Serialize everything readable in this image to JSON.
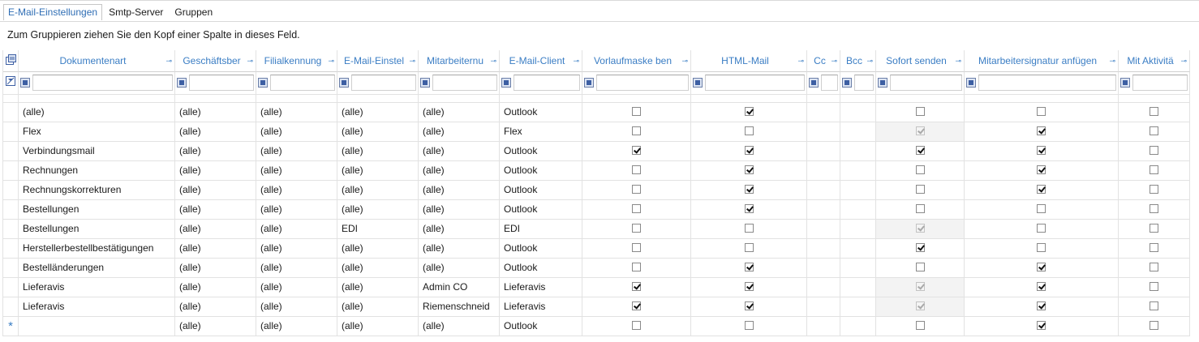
{
  "tabs": [
    "E-Mail-Einstellungen",
    "Smtp-Server",
    "Gruppen"
  ],
  "group_hint": "Zum Gruppieren ziehen Sie den Kopf einer Spalte in dieses Feld.",
  "columns": [
    "Dokumentenart",
    "Geschäftsber",
    "Filialkennung",
    "E-Mail-Einstel",
    "Mitarbeiternu",
    "E-Mail-Client",
    "Vorlaufmaske ben",
    "HTML-Mail",
    "Cc",
    "Bcc",
    "Sofort senden",
    "Mitarbeitersignatur anfügen",
    "Mit Aktivitä"
  ],
  "rows": [
    {
      "dok": "(alle)",
      "gesch": "(alle)",
      "filial": "(alle)",
      "einst": "(alle)",
      "mitarb": "(alle)",
      "client": "Outlook",
      "vorlauf": false,
      "html": true,
      "sofort": false,
      "sofort_disabled": false,
      "signatur": false,
      "aktiv": false
    },
    {
      "dok": "Flex",
      "gesch": "(alle)",
      "filial": "(alle)",
      "einst": "(alle)",
      "mitarb": "(alle)",
      "client": "Flex",
      "vorlauf": false,
      "html": false,
      "sofort": true,
      "sofort_disabled": true,
      "signatur": true,
      "aktiv": false
    },
    {
      "dok": "Verbindungsmail",
      "gesch": "(alle)",
      "filial": "(alle)",
      "einst": "(alle)",
      "mitarb": "(alle)",
      "client": "Outlook",
      "vorlauf": true,
      "html": true,
      "sofort": true,
      "sofort_disabled": false,
      "signatur": true,
      "aktiv": false
    },
    {
      "dok": "Rechnungen",
      "gesch": "(alle)",
      "filial": "(alle)",
      "einst": "(alle)",
      "mitarb": "(alle)",
      "client": "Outlook",
      "vorlauf": false,
      "html": true,
      "sofort": false,
      "sofort_disabled": false,
      "signatur": true,
      "aktiv": false
    },
    {
      "dok": "Rechnungskorrekturen",
      "gesch": "(alle)",
      "filial": "(alle)",
      "einst": "(alle)",
      "mitarb": "(alle)",
      "client": "Outlook",
      "vorlauf": false,
      "html": true,
      "sofort": false,
      "sofort_disabled": false,
      "signatur": true,
      "aktiv": false
    },
    {
      "dok": "Bestellungen",
      "gesch": "(alle)",
      "filial": "(alle)",
      "einst": "(alle)",
      "mitarb": "(alle)",
      "client": "Outlook",
      "vorlauf": false,
      "html": true,
      "sofort": false,
      "sofort_disabled": false,
      "signatur": false,
      "aktiv": false
    },
    {
      "dok": "Bestellungen",
      "gesch": "(alle)",
      "filial": "(alle)",
      "einst": "EDI",
      "mitarb": "(alle)",
      "client": "EDI",
      "vorlauf": false,
      "html": false,
      "sofort": true,
      "sofort_disabled": true,
      "signatur": false,
      "aktiv": false
    },
    {
      "dok": "Herstellerbestellbestätigungen",
      "gesch": "(alle)",
      "filial": "(alle)",
      "einst": "(alle)",
      "mitarb": "(alle)",
      "client": "Outlook",
      "vorlauf": false,
      "html": false,
      "sofort": true,
      "sofort_disabled": false,
      "signatur": false,
      "aktiv": false
    },
    {
      "dok": "Bestelländerungen",
      "gesch": "(alle)",
      "filial": "(alle)",
      "einst": "(alle)",
      "mitarb": "(alle)",
      "client": "Outlook",
      "vorlauf": false,
      "html": true,
      "sofort": false,
      "sofort_disabled": false,
      "signatur": true,
      "aktiv": false
    },
    {
      "dok": "Lieferavis",
      "gesch": "(alle)",
      "filial": "(alle)",
      "einst": "(alle)",
      "mitarb": "Admin CO",
      "client": "Lieferavis",
      "vorlauf": true,
      "html": true,
      "sofort": true,
      "sofort_disabled": true,
      "signatur": true,
      "aktiv": false
    },
    {
      "dok": "Lieferavis",
      "gesch": "(alle)",
      "filial": "(alle)",
      "einst": "(alle)",
      "mitarb": "Riemenschneid",
      "client": "Lieferavis",
      "vorlauf": true,
      "html": true,
      "sofort": true,
      "sofort_disabled": true,
      "signatur": true,
      "aktiv": false
    }
  ],
  "new_row": {
    "marker": "*",
    "dok": "",
    "gesch": "(alle)",
    "filial": "(alle)",
    "einst": "(alle)",
    "mitarb": "(alle)",
    "client": "Outlook",
    "vorlauf": false,
    "html": false,
    "sofort": false,
    "sofort_disabled": false,
    "signatur": true,
    "aktiv": false
  },
  "icons": {
    "column_chooser": "column-chooser-icon",
    "filter_clear": "filter-clear-icon",
    "pin": "pin-icon",
    "new_row": "new-row-asterisk-icon"
  },
  "colors": {
    "accent": "#3a7dc4",
    "grid_line": "#e2e2e2"
  }
}
